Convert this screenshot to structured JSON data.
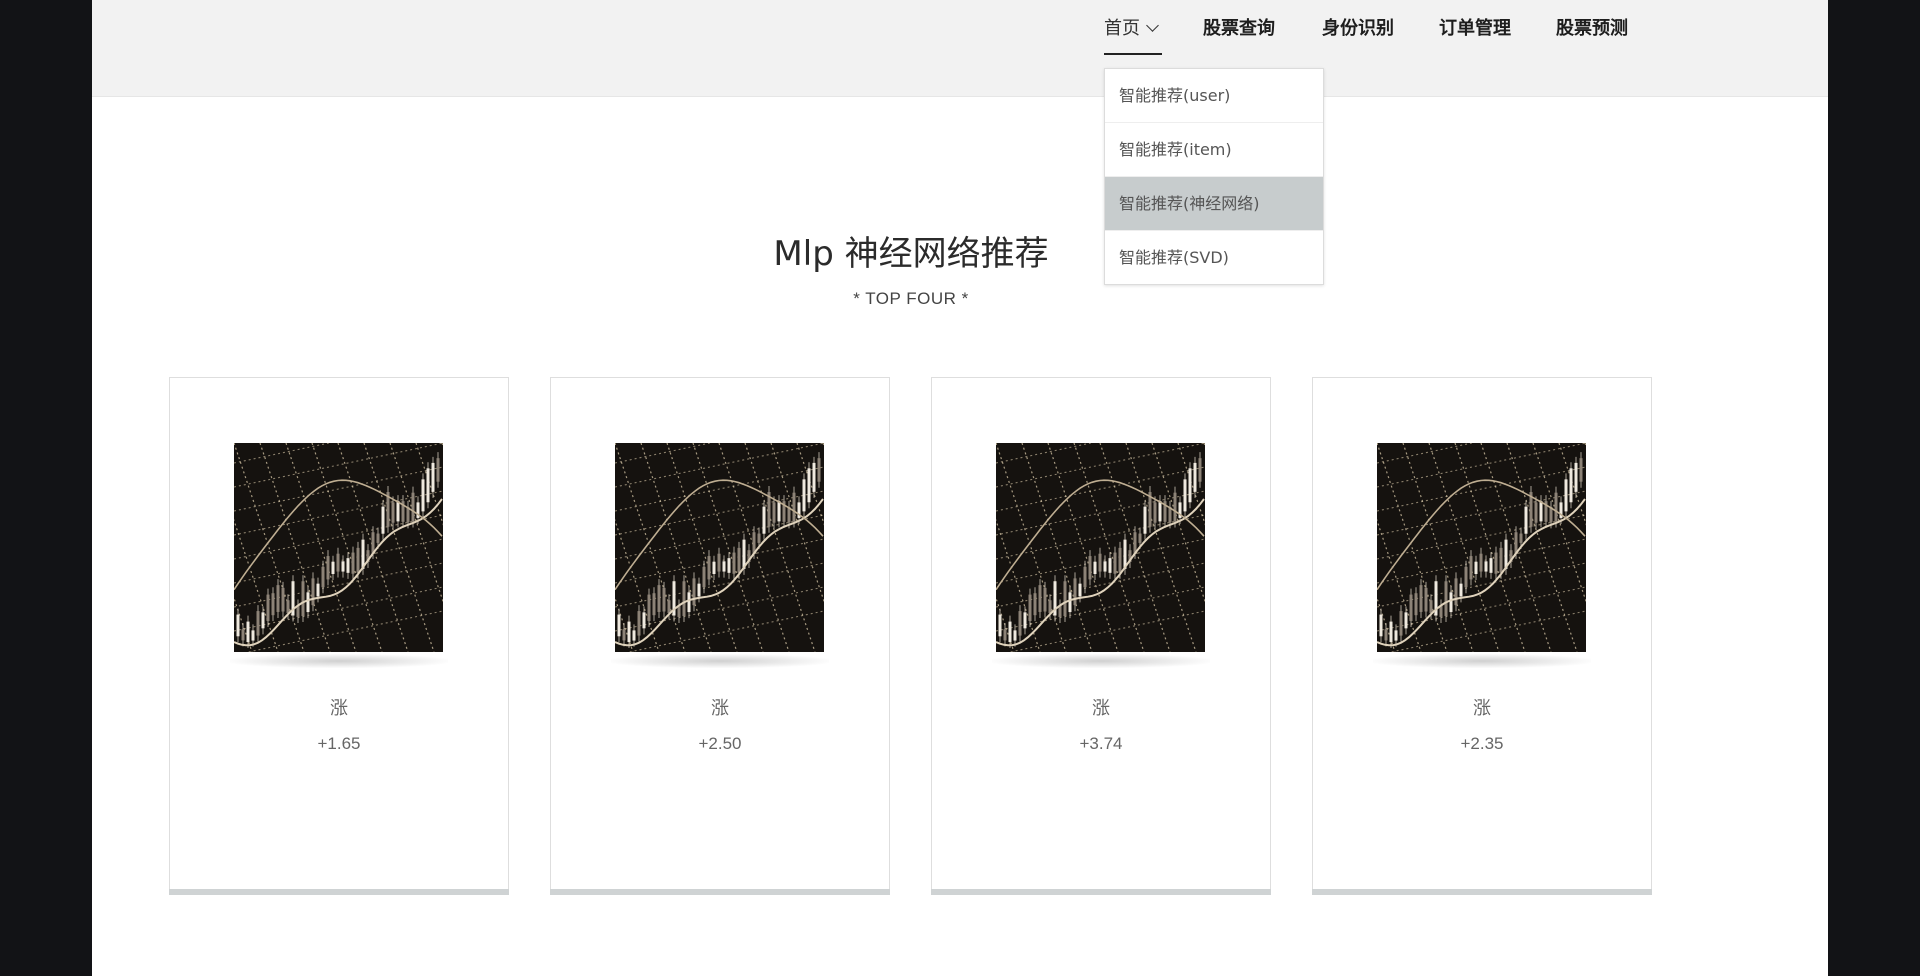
{
  "nav": {
    "items": [
      {
        "label": "首页",
        "active": true
      },
      {
        "label": "股票查询"
      },
      {
        "label": "身份识别"
      },
      {
        "label": "订单管理"
      },
      {
        "label": "股票预测"
      }
    ],
    "dropdown": [
      {
        "label": "智能推荐(user)"
      },
      {
        "label": "智能推荐(item)"
      },
      {
        "label": "智能推荐(神经网络)",
        "highlighted": true
      },
      {
        "label": "智能推荐(SVD)"
      }
    ]
  },
  "main": {
    "title": "Mlp 神经网络推荐",
    "subtitle": "* TOP FOUR *",
    "cards": [
      {
        "label": "涨",
        "value": "+1.65",
        "image": "stock-chart-image"
      },
      {
        "label": "涨",
        "value": "+2.50",
        "image": "stock-chart-image"
      },
      {
        "label": "涨",
        "value": "+3.74",
        "image": "stock-chart-image"
      },
      {
        "label": "涨",
        "value": "+2.35",
        "image": "stock-chart-image"
      }
    ]
  },
  "colors": {
    "outer_background": "#121316",
    "header_background": "#f2f2f2",
    "dropdown_highlight": "#c7cccd",
    "card_bottom_bar": "#cfd3d4"
  }
}
